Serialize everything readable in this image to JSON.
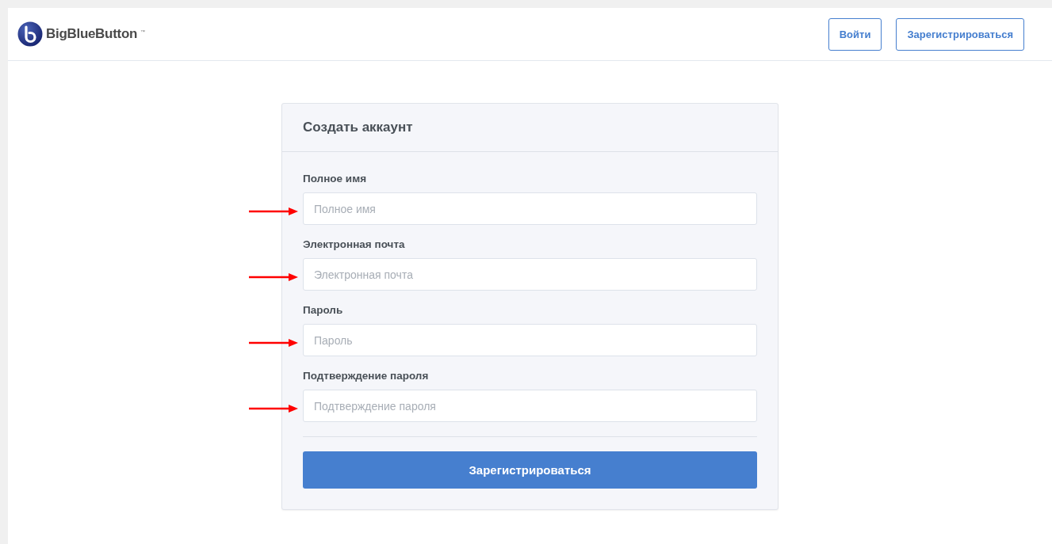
{
  "header": {
    "logo_text": "BigBlueButton",
    "logo_mark": "™",
    "buttons": [
      {
        "label": "Войти"
      },
      {
        "label": "Зарегистрироваться"
      }
    ]
  },
  "card": {
    "title": "Создать аккаунт",
    "fields": [
      {
        "label": "Полное имя",
        "placeholder": "Полное имя",
        "annotated": true
      },
      {
        "label": "Электронная почта",
        "placeholder": "Электронная почта",
        "annotated": true
      },
      {
        "label": "Пароль",
        "placeholder": "Пароль",
        "annotated": true
      },
      {
        "label": "Подтверждение пароля",
        "placeholder": "Подтверждение пароля",
        "annotated": true
      }
    ],
    "submit": "Зарегистрироваться"
  }
}
